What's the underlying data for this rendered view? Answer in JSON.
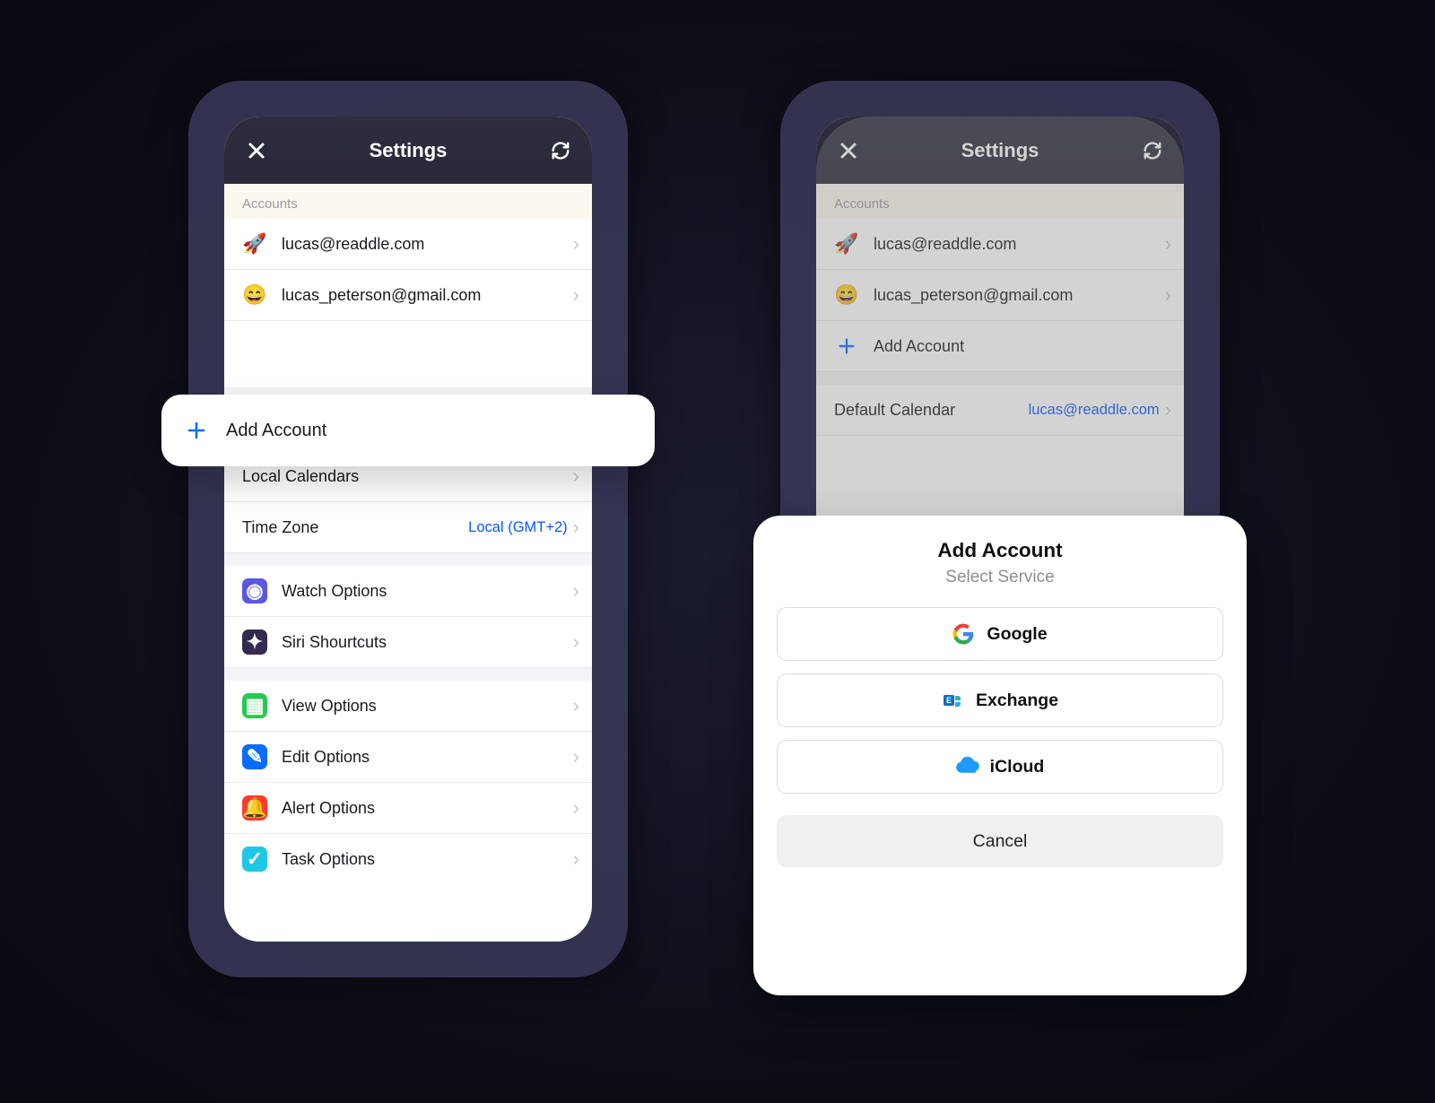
{
  "header": {
    "title": "Settings"
  },
  "accounts": {
    "section_label": "Accounts",
    "items": [
      {
        "email": "lucas@readdle.com"
      },
      {
        "email": "lucas_peterson@gmail.com"
      }
    ],
    "add_label": "Add Account"
  },
  "calendar": {
    "default_label": "Default Calendar",
    "default_value": "lucas@readdle.com",
    "local_label": "Local Calendars",
    "timezone_label": "Time Zone",
    "timezone_value": "Local (GMT+2)"
  },
  "integrations": {
    "watch_label": "Watch Options",
    "siri_label": "Siri Shourtcuts"
  },
  "options": {
    "view_label": "View Options",
    "edit_label": "Edit Options",
    "alert_label": "Alert Options",
    "task_label": "Task Options"
  },
  "sheet": {
    "title": "Add Account",
    "subtitle": "Select Service",
    "services": {
      "google": "Google",
      "exchange": "Exchange",
      "icloud": "iCloud"
    },
    "cancel": "Cancel"
  }
}
